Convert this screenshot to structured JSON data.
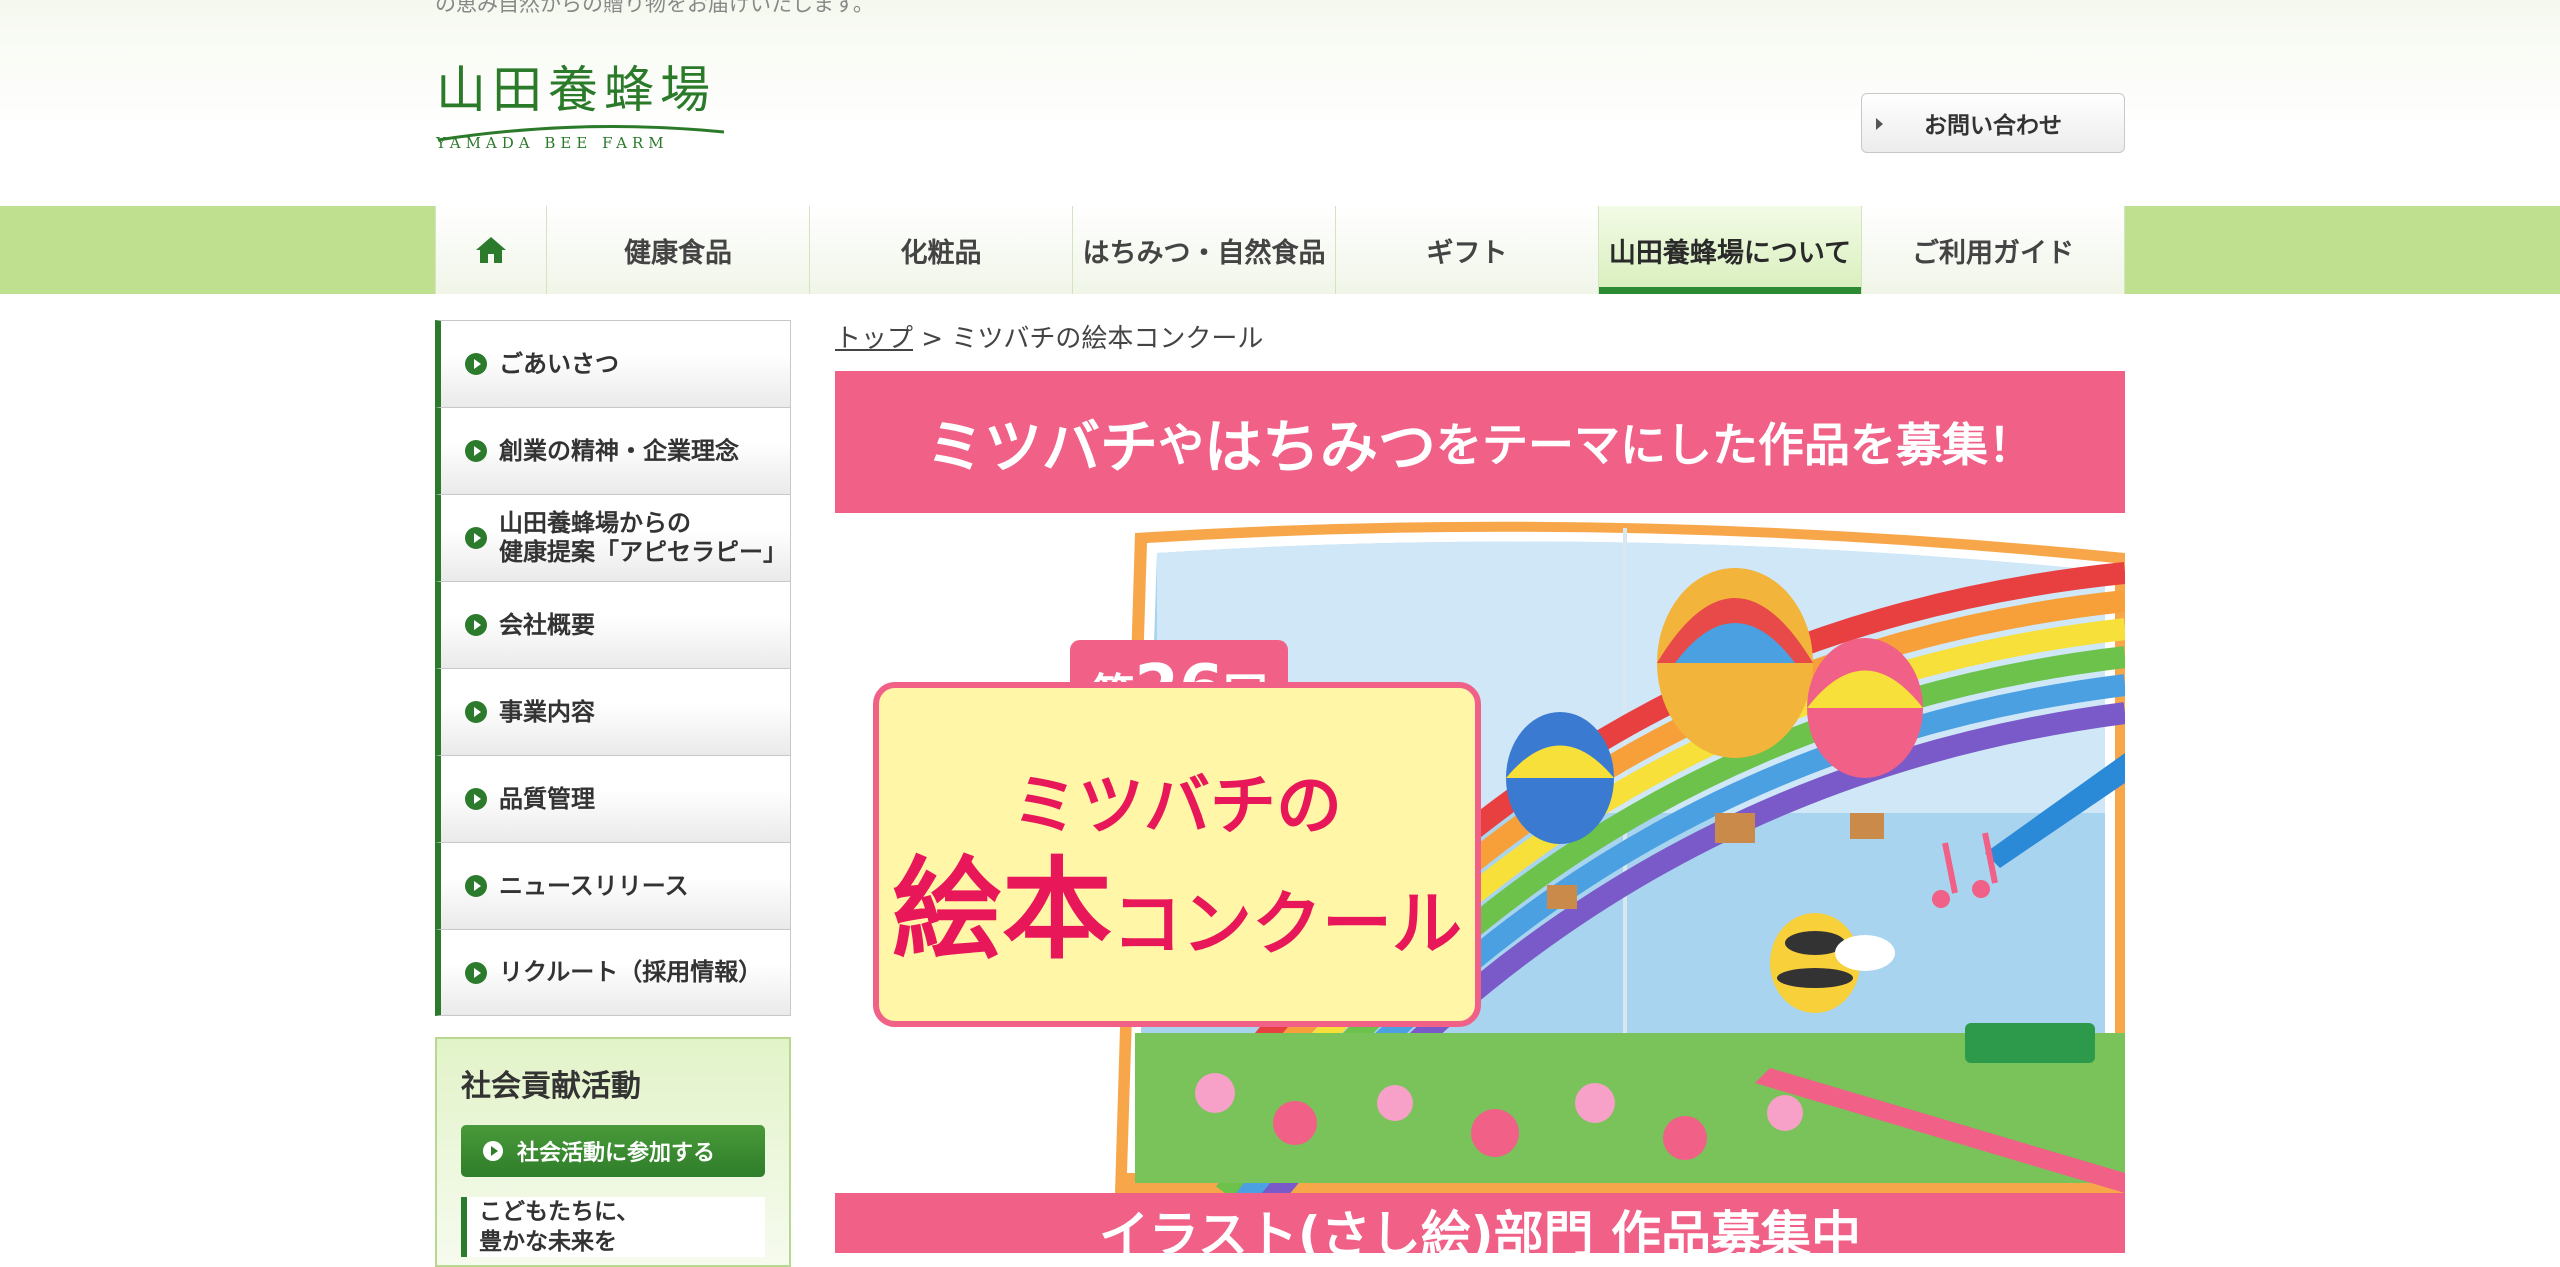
{
  "header": {
    "tagline": "の恵み自然からの贈り物をお届けいたします。",
    "logo_jp": "山田養蜂場",
    "logo_en": "YAMADA BEE FARM",
    "contact_label": "お問い合わせ"
  },
  "nav": {
    "home_icon": "home-icon",
    "items": [
      {
        "label": "健康食品"
      },
      {
        "label": "化粧品"
      },
      {
        "label": "はちみつ・自然食品"
      },
      {
        "label": "ギフト"
      },
      {
        "label": "山田養蜂場について",
        "active": true
      },
      {
        "label": "ご利用ガイド"
      }
    ]
  },
  "sidebar": {
    "items": [
      {
        "label": "ごあいさつ"
      },
      {
        "label": "創業の精神・企業理念"
      },
      {
        "label": "山田養蜂場からの\n健康提案「アピセラピー」"
      },
      {
        "label": "会社概要"
      },
      {
        "label": "事業内容"
      },
      {
        "label": "品質管理"
      },
      {
        "label": "ニュースリリース"
      },
      {
        "label": "リクルート（採用情報）"
      }
    ],
    "csr": {
      "title": "社会貢献活動",
      "button_label": "社会活動に参加する",
      "sub_label": "こどもたちに、\n豊かな未来を"
    }
  },
  "breadcrumb": {
    "home_label": "トップ",
    "separator": ">",
    "current_label": "ミツバチの絵本コンクール"
  },
  "hero": {
    "banner_big1": "ミツバチ",
    "banner_small1": "や",
    "banner_big2": "はちみつ",
    "banner_small2": "をテーマにした作品を募集！",
    "badge_prefix": "第",
    "badge_number": "26",
    "badge_suffix": "回",
    "title_line1": "ミツバチの",
    "title_big": "絵本",
    "title_small": "コンクール",
    "bottom_banner": "イラスト(さし絵)部門 作品募集中"
  },
  "colors": {
    "brand_green": "#2c7a2c",
    "nav_band": "#bfe08e",
    "hero_pink": "#f06087",
    "card_yellow": "#fff6a8"
  }
}
